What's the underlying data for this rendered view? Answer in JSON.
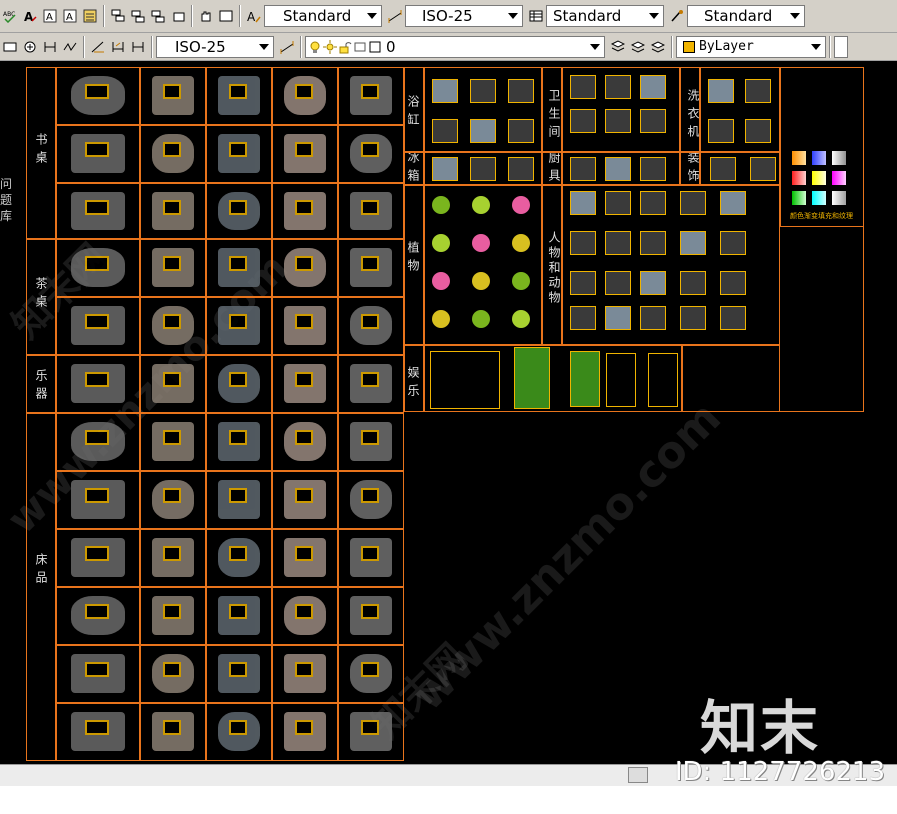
{
  "toolbar1": {
    "text_style": "Standard",
    "dim_style": "ISO-25",
    "table_style": "Standard",
    "multileader_style": "Standard"
  },
  "toolbar2": {
    "dim_style2": "ISO-25",
    "layer": "0",
    "color": "ByLayer"
  },
  "left_edge_labels": [
    "问题",
    "库"
  ],
  "categories": {
    "desk": "书桌",
    "tea_table": "茶桌",
    "instrument": "乐器",
    "bedding": "床品",
    "bathtub": "浴缸",
    "bathroom": "卫生间",
    "washer": "洗衣机",
    "fridge": "冰箱",
    "kitchenware": "厨具",
    "decoration": "装饰",
    "plants": "植物",
    "people_animals": "人物和动物",
    "entertainment": "娱乐"
  },
  "color_panel_label": "颜色渐变填充和纹理",
  "watermark": {
    "brand": "知末",
    "site": "www.znzmo.com",
    "site_cn": "知末网"
  },
  "image_id": "ID: 1127726213",
  "colors": {
    "grid": "#e8741c",
    "symbol": "#f0b400",
    "background": "#000000"
  }
}
